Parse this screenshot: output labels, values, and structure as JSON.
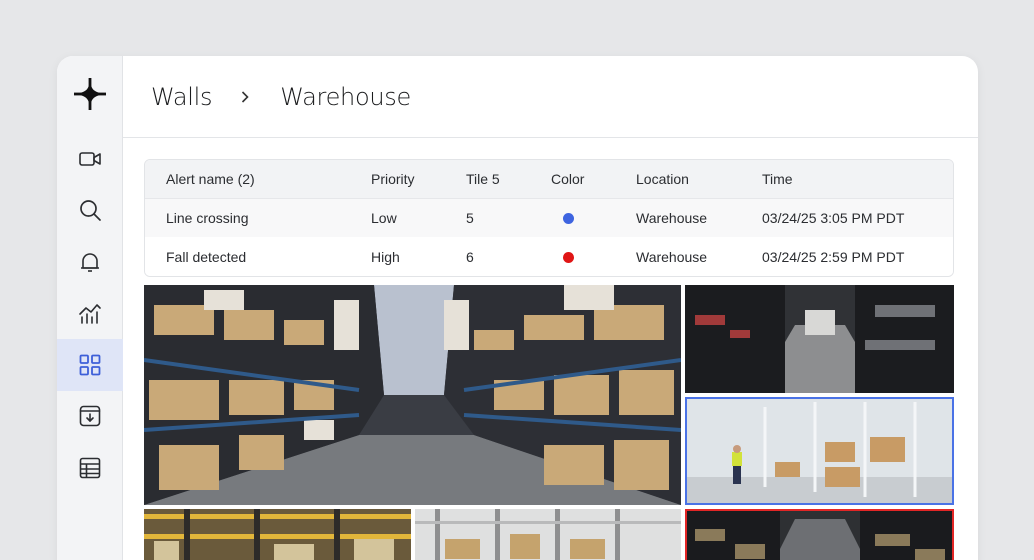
{
  "breadcrumb": {
    "parent": "Walls",
    "current": "Warehouse"
  },
  "sidebar": {
    "items": [
      {
        "icon": "video-camera-icon",
        "active": false
      },
      {
        "icon": "search-icon",
        "active": false
      },
      {
        "icon": "bell-icon",
        "active": false
      },
      {
        "icon": "analytics-chart-icon",
        "active": false
      },
      {
        "icon": "grid-icon",
        "active": true
      },
      {
        "icon": "archive-download-icon",
        "active": false
      },
      {
        "icon": "table-icon",
        "active": false
      }
    ]
  },
  "alerts_table": {
    "headers": [
      "Alert name (2)",
      "Priority",
      "Tile 5",
      "Color",
      "Location",
      "Time"
    ],
    "rows": [
      {
        "name": "Line crossing",
        "priority": "Low",
        "tile": "5",
        "color": "#3e64e0",
        "location": "Warehouse",
        "time": "03/24/25 3:05 PM PDT"
      },
      {
        "name": "Fall detected",
        "priority": "High",
        "tile": "6",
        "color": "#e01515",
        "location": "Warehouse",
        "time": "03/24/25 2:59 PM PDT"
      }
    ]
  },
  "camera_tiles": [
    {
      "label": "camera-feed-1"
    },
    {
      "label": "camera-feed-2"
    },
    {
      "label": "camera-feed-3",
      "highlight": "#4a72e6"
    },
    {
      "label": "camera-feed-4"
    },
    {
      "label": "camera-feed-5"
    },
    {
      "label": "camera-feed-6",
      "highlight": "#e22626"
    }
  ]
}
